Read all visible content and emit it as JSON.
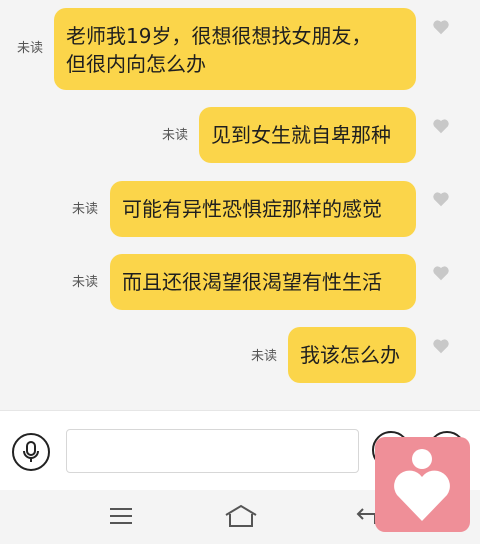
{
  "messages": [
    {
      "text": "老师我19岁，很想很想找女朋友，\n但很内向怎么办",
      "status": "未读"
    },
    {
      "text": "见到女生就自卑那种",
      "status": "未读"
    },
    {
      "text": "可能有异性恐惧症那样的感觉",
      "status": "未读"
    },
    {
      "text": "而且还很渴望很渴望有性生活",
      "status": "未读"
    },
    {
      "text": "我该怎么办",
      "status": "未读"
    }
  ],
  "composer": {
    "input_value": "",
    "input_placeholder": ""
  },
  "icons": {
    "voice": "microphone-icon",
    "emoji": "circle-button",
    "more": "circle-button",
    "like": "heart-icon",
    "nav_menu": "menu-icon",
    "nav_home": "home-icon",
    "nav_back": "back-icon",
    "app_logo": "heart-person-logo"
  },
  "colors": {
    "bubble": "#fbd54a",
    "background": "#f4f4f4",
    "logo": "#ef8f98"
  }
}
